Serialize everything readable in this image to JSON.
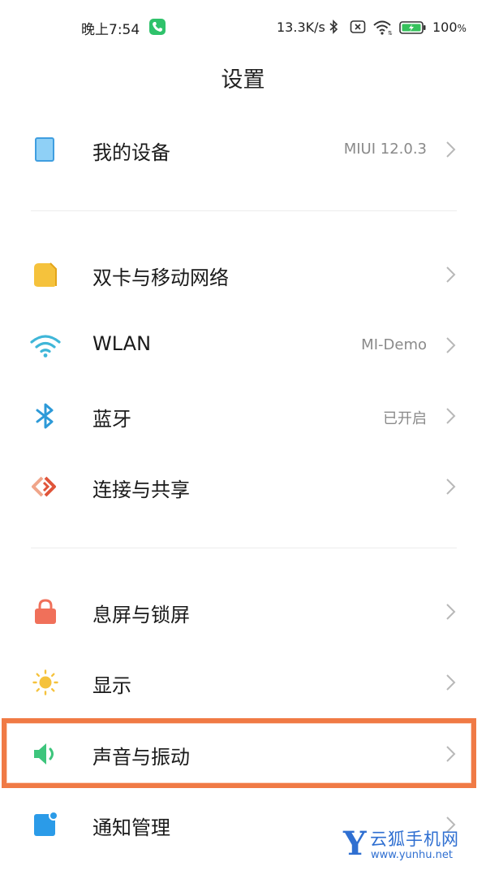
{
  "status_bar": {
    "time": "晚上7:54",
    "net_speed": "13.3K/s",
    "battery": "100",
    "battery_unit": "%"
  },
  "header": {
    "title": "设置"
  },
  "rows": [
    {
      "label": "我的设备",
      "value": "MIUI 12.0.3",
      "icon": "tablet-icon"
    },
    {
      "label": "双卡与移动网络",
      "value": "",
      "icon": "sim-card-icon"
    },
    {
      "label": "WLAN",
      "value": "MI-Demo",
      "icon": "wifi-icon"
    },
    {
      "label": "蓝牙",
      "value": "已开启",
      "icon": "bluetooth-icon"
    },
    {
      "label": "连接与共享",
      "value": "",
      "icon": "share-icon"
    },
    {
      "label": "息屏与锁屏",
      "value": "",
      "icon": "lock-icon"
    },
    {
      "label": "显示",
      "value": "",
      "icon": "sun-icon"
    },
    {
      "label": "声音与振动",
      "value": "",
      "icon": "speaker-icon"
    },
    {
      "label": "通知管理",
      "value": "",
      "icon": "notification-icon"
    }
  ],
  "colors": {
    "highlight_border": "#f07a45",
    "watermark": "#2f6fd1"
  },
  "watermark": {
    "mark": "Y",
    "name": "云狐手机网",
    "url": "www.yunhu.net"
  }
}
